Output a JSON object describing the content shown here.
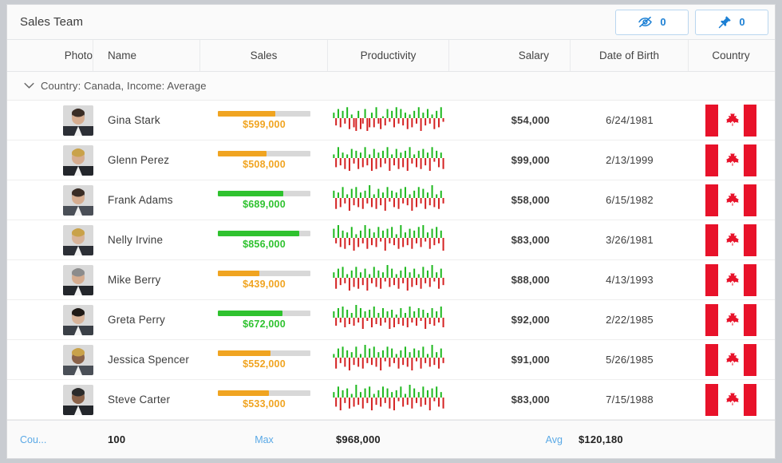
{
  "window": {
    "title": "Sales Team"
  },
  "toolbar": {
    "hidden_columns_button": {
      "icon": "eye-slash-icon",
      "count": "0"
    },
    "pinned_columns_button": {
      "icon": "pin-icon",
      "count": "0"
    }
  },
  "columns": [
    {
      "key": "photo",
      "label": "Photo"
    },
    {
      "key": "name",
      "label": "Name"
    },
    {
      "key": "sales",
      "label": "Sales"
    },
    {
      "key": "productivity",
      "label": "Productivity"
    },
    {
      "key": "salary",
      "label": "Salary"
    },
    {
      "key": "dob",
      "label": "Date of Birth"
    },
    {
      "key": "country",
      "label": "Country"
    }
  ],
  "group": {
    "label": "Country: Canada, Income: Average",
    "expanded": true,
    "chevron_icon": "chevron-down-icon"
  },
  "colors": {
    "bar_green": "#2fc22f",
    "bar_orange": "#f0a421",
    "bar_track": "#d8d8d8",
    "accent_blue": "#1b7fd4",
    "link_blue": "#5aa9e6",
    "spark_up": "#1db81d",
    "spark_down": "#d42121",
    "flag_red": "#e8122a"
  },
  "rows": [
    {
      "name": "Gina Stark",
      "sales": "$599,000",
      "sales_pct": 62,
      "sales_color": "#f0a421",
      "salary": "$54,000",
      "dob": "6/24/1981",
      "country": "Canada",
      "flag": "canada-flag-icon",
      "avatar": "avatar-gina-stark",
      "spark": [
        3,
        -4,
        5,
        -5,
        4,
        -3,
        6,
        -6,
        2,
        -5,
        -7,
        4,
        -6,
        -3,
        5,
        -7,
        -5,
        3,
        -5,
        6,
        -3,
        -6,
        1,
        -4,
        5,
        -2,
        4,
        -5,
        6,
        -3,
        5,
        -4,
        3,
        -6,
        2,
        -5,
        4,
        -3,
        6,
        -7,
        3,
        -4,
        5,
        -3,
        2,
        -6,
        4,
        -5,
        6,
        -2
      ]
    },
    {
      "name": "Glenn Perez",
      "sales": "$508,000",
      "sales_pct": 53,
      "sales_color": "#f0a421",
      "salary": "$99,000",
      "dob": "2/13/1999",
      "country": "Canada",
      "flag": "canada-flag-icon",
      "avatar": "avatar-glenn-perez",
      "spark": [
        2,
        -5,
        6,
        -4,
        3,
        -6,
        2,
        -7,
        5,
        -3,
        4,
        -6,
        3,
        -5,
        6,
        -4,
        2,
        -7,
        5,
        -6,
        3,
        -5,
        4,
        -3,
        6,
        -7,
        2,
        -4,
        5,
        -6,
        3,
        -5,
        4,
        -7,
        6,
        -3,
        2,
        -5,
        4,
        -6,
        5,
        -4,
        3,
        -7,
        6,
        -2,
        4,
        -5,
        3,
        -6
      ]
    },
    {
      "name": "Frank Adams",
      "sales": "$689,000",
      "sales_pct": 71,
      "sales_color": "#2fc22f",
      "salary": "$58,000",
      "dob": "6/15/1982",
      "country": "Canada",
      "flag": "canada-flag-icon",
      "avatar": "avatar-frank-adams",
      "spark": [
        4,
        -6,
        3,
        -5,
        6,
        -3,
        2,
        -7,
        5,
        -4,
        6,
        -5,
        3,
        -6,
        4,
        -3,
        7,
        -5,
        2,
        -6,
        5,
        -4,
        3,
        -7,
        6,
        -2,
        4,
        -5,
        3,
        -6,
        5,
        -3,
        6,
        -4,
        2,
        -7,
        4,
        -5,
        6,
        -3,
        5,
        -6,
        3,
        -4,
        7,
        -5,
        2,
        -6,
        4,
        -3
      ]
    },
    {
      "name": "Nelly Irvine",
      "sales": "$856,000",
      "sales_pct": 88,
      "sales_color": "#2fc22f",
      "salary": "$83,000",
      "dob": "3/26/1981",
      "country": "Canada",
      "flag": "canada-flag-icon",
      "avatar": "avatar-nelly-irvine",
      "spark": [
        5,
        -3,
        7,
        -5,
        4,
        -6,
        3,
        -4,
        6,
        -7,
        2,
        -5,
        4,
        -3,
        7,
        -6,
        5,
        -4,
        3,
        -5,
        6,
        -2,
        4,
        -7,
        5,
        -3,
        6,
        -4,
        2,
        -6,
        7,
        -5,
        3,
        -4,
        5,
        -6,
        4,
        -3,
        6,
        -5,
        7,
        -2,
        3,
        -6,
        5,
        -4,
        6,
        -3,
        4,
        -7
      ]
    },
    {
      "name": "Mike Berry",
      "sales": "$439,000",
      "sales_pct": 45,
      "sales_color": "#f0a421",
      "salary": "$88,000",
      "dob": "4/13/1993",
      "country": "Canada",
      "flag": "canada-flag-icon",
      "avatar": "avatar-mike-berry",
      "spark": [
        3,
        -6,
        5,
        -4,
        6,
        -3,
        2,
        -7,
        4,
        -5,
        6,
        -6,
        3,
        -4,
        5,
        -7,
        2,
        -3,
        6,
        -5,
        4,
        -6,
        3,
        -2,
        7,
        -5,
        5,
        -4,
        2,
        -6,
        4,
        -3,
        6,
        -7,
        3,
        -5,
        5,
        -4,
        2,
        -6,
        6,
        -3,
        4,
        -5,
        7,
        -2,
        3,
        -6,
        5,
        -4
      ]
    },
    {
      "name": "Greta Perry",
      "sales": "$672,000",
      "sales_pct": 70,
      "sales_color": "#2fc22f",
      "salary": "$92,000",
      "dob": "2/22/1985",
      "country": "Canada",
      "flag": "canada-flag-icon",
      "avatar": "avatar-greta-perry",
      "spark": [
        4,
        -5,
        6,
        -3,
        7,
        -6,
        5,
        -4,
        3,
        -5,
        8,
        -3,
        6,
        -7,
        4,
        -2,
        5,
        -6,
        7,
        -4,
        3,
        -5,
        6,
        -3,
        4,
        -7,
        5,
        -6,
        2,
        -4,
        6,
        -5,
        3,
        -6,
        7,
        -3,
        4,
        -5,
        6,
        -2,
        5,
        -7,
        3,
        -4,
        6,
        -5,
        4,
        -3,
        7,
        -6
      ]
    },
    {
      "name": "Jessica Spencer",
      "sales": "$552,000",
      "sales_pct": 57,
      "sales_color": "#f0a421",
      "salary": "$91,000",
      "dob": "5/26/1985",
      "country": "Canada",
      "flag": "canada-flag-icon",
      "avatar": "avatar-jessica-spencer",
      "spark": [
        2,
        -6,
        5,
        -3,
        6,
        -5,
        4,
        -7,
        3,
        -4,
        6,
        -5,
        2,
        -6,
        7,
        -3,
        5,
        -4,
        6,
        -5,
        3,
        -7,
        4,
        -2,
        6,
        -5,
        5,
        -3,
        2,
        -6,
        4,
        -4,
        6,
        -5,
        3,
        -7,
        5,
        -2,
        4,
        -6,
        6,
        -3,
        2,
        -5,
        7,
        -4,
        3,
        -6,
        5,
        -3
      ]
    },
    {
      "name": "Steve Carter",
      "sales": "$533,000",
      "sales_pct": 55,
      "sales_color": "#f0a421",
      "salary": "$83,000",
      "dob": "7/15/1988",
      "country": "Canada",
      "flag": "canada-flag-icon",
      "avatar": "avatar-steve-carter",
      "spark": [
        3,
        -5,
        6,
        -7,
        4,
        -3,
        5,
        -6,
        2,
        -5,
        7,
        -4,
        3,
        -6,
        5,
        -3,
        6,
        -7,
        2,
        -4,
        4,
        -5,
        6,
        -3,
        5,
        -6,
        3,
        -7,
        4,
        -2,
        6,
        -5,
        2,
        -4,
        7,
        -6,
        5,
        -3,
        3,
        -5,
        6,
        -4,
        4,
        -7,
        5,
        -2,
        6,
        -5,
        3,
        -6
      ]
    }
  ],
  "footer": {
    "count_label": "Cou...",
    "count_value": "100",
    "max_label": "Max",
    "max_value": "$968,000",
    "avg_label": "Avg",
    "avg_value": "$120,180"
  }
}
